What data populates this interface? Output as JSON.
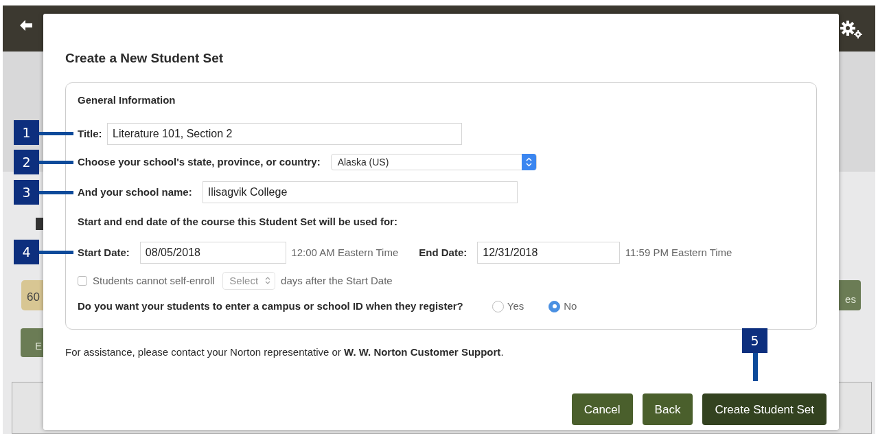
{
  "background_page": {
    "badge": "60",
    "left_button": "E",
    "right_button": "es"
  },
  "dialog": {
    "title": "Create a New Student Set",
    "section_title": "General Information",
    "title_field": {
      "label": "Title:",
      "value": "Literature 101, Section 2"
    },
    "region_field": {
      "label": "Choose your school's state, province, or country:",
      "value": "Alaska (US)"
    },
    "school_field": {
      "label": "And your school name:",
      "value": "Ilisagvik College"
    },
    "dates_heading": "Start and end date of the course this Student Set will be used for:",
    "start_date": {
      "label": "Start Date:",
      "value": "08/05/2018",
      "note": "12:00 AM Eastern Time"
    },
    "end_date": {
      "label": "End Date:",
      "value": "12/31/2018",
      "note": "11:59 PM Eastern Time"
    },
    "self_enroll": {
      "label": "Students cannot self-enroll",
      "checked": false,
      "select_value": "Select",
      "suffix": "days after the Start Date",
      "disabled": true
    },
    "id_question": {
      "label": "Do you want your students to enter a campus or school ID when they register?",
      "options": [
        {
          "label": "Yes",
          "selected": false
        },
        {
          "label": "No",
          "selected": true
        }
      ]
    },
    "footer": "For assistance, please contact your Norton representative or **W. W. Norton Customer Support**.",
    "buttons": [
      {
        "label": "Cancel",
        "kind": "secondary"
      },
      {
        "label": "Back",
        "kind": "secondary"
      },
      {
        "label": "Create Student Set",
        "kind": "primary"
      }
    ]
  },
  "callouts": [
    "1",
    "2",
    "3",
    "4",
    "5"
  ]
}
